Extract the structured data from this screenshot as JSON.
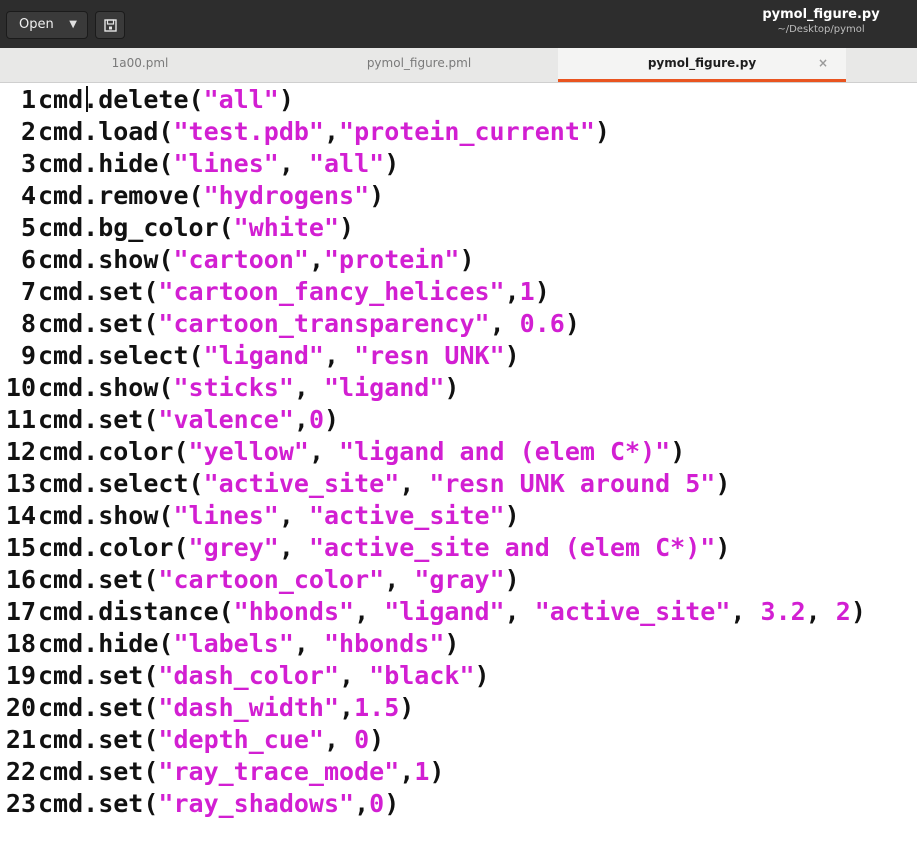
{
  "window": {
    "open_label": "Open",
    "title": "pymol_figure.py",
    "path": "~/Desktop/pymol"
  },
  "tabs": [
    {
      "label": "1a00.pml",
      "active": false
    },
    {
      "label": "pymol_figure.pml",
      "active": false
    },
    {
      "label": "pymol_figure.py",
      "active": true,
      "close": "×"
    }
  ],
  "colors": {
    "string": "#d21fd2",
    "text": "#111111",
    "tab_accent": "#e95420"
  },
  "code_lines": [
    [
      [
        "n",
        "1"
      ],
      [
        "p",
        "cmd.delete("
      ],
      [
        "s",
        "\"all\""
      ],
      [
        "p",
        ")"
      ]
    ],
    [
      [
        "n",
        "2"
      ],
      [
        "p",
        "cmd.load("
      ],
      [
        "s",
        "\"test.pdb\""
      ],
      [
        "p",
        ","
      ],
      [
        "s",
        "\"protein_current\""
      ],
      [
        "p",
        ")"
      ]
    ],
    [
      [
        "n",
        "3"
      ],
      [
        "p",
        "cmd.hide("
      ],
      [
        "s",
        "\"lines\""
      ],
      [
        "p",
        ", "
      ],
      [
        "s",
        "\"all\""
      ],
      [
        "p",
        ")"
      ]
    ],
    [
      [
        "n",
        "4"
      ],
      [
        "p",
        "cmd.remove("
      ],
      [
        "s",
        "\"hydrogens\""
      ],
      [
        "p",
        ")"
      ]
    ],
    [
      [
        "n",
        "5"
      ],
      [
        "p",
        "cmd.bg_color("
      ],
      [
        "s",
        "\"white\""
      ],
      [
        "p",
        ")"
      ]
    ],
    [
      [
        "n",
        "6"
      ],
      [
        "p",
        "cmd.show("
      ],
      [
        "s",
        "\"cartoon\""
      ],
      [
        "p",
        ","
      ],
      [
        "s",
        "\"protein\""
      ],
      [
        "p",
        ")"
      ]
    ],
    [
      [
        "n",
        "7"
      ],
      [
        "p",
        "cmd.set("
      ],
      [
        "s",
        "\"cartoon_fancy_helices\""
      ],
      [
        "p",
        ","
      ],
      [
        "s",
        "1"
      ],
      [
        "p",
        ")"
      ]
    ],
    [
      [
        "n",
        "8"
      ],
      [
        "p",
        "cmd.set("
      ],
      [
        "s",
        "\"cartoon_transparency\""
      ],
      [
        "p",
        ", "
      ],
      [
        "s",
        "0.6"
      ],
      [
        "p",
        ")"
      ]
    ],
    [
      [
        "n",
        "9"
      ],
      [
        "p",
        "cmd.select("
      ],
      [
        "s",
        "\"ligand\""
      ],
      [
        "p",
        ", "
      ],
      [
        "s",
        "\"resn UNK\""
      ],
      [
        "p",
        ")"
      ]
    ],
    [
      [
        "n",
        "10"
      ],
      [
        "p",
        "cmd.show("
      ],
      [
        "s",
        "\"sticks\""
      ],
      [
        "p",
        ", "
      ],
      [
        "s",
        "\"ligand\""
      ],
      [
        "p",
        ")"
      ]
    ],
    [
      [
        "n",
        "11"
      ],
      [
        "p",
        "cmd.set("
      ],
      [
        "s",
        "\"valence\""
      ],
      [
        "p",
        ","
      ],
      [
        "s",
        "0"
      ],
      [
        "p",
        ")"
      ]
    ],
    [
      [
        "n",
        "12"
      ],
      [
        "p",
        "cmd.color("
      ],
      [
        "s",
        "\"yellow\""
      ],
      [
        "p",
        ", "
      ],
      [
        "s",
        "\"ligand and (elem C*)\""
      ],
      [
        "p",
        ")"
      ]
    ],
    [
      [
        "n",
        "13"
      ],
      [
        "p",
        "cmd.select("
      ],
      [
        "s",
        "\"active_site\""
      ],
      [
        "p",
        ", "
      ],
      [
        "s",
        "\"resn UNK around 5\""
      ],
      [
        "p",
        ")"
      ]
    ],
    [
      [
        "n",
        "14"
      ],
      [
        "p",
        "cmd.show("
      ],
      [
        "s",
        "\"lines\""
      ],
      [
        "p",
        ", "
      ],
      [
        "s",
        "\"active_site\""
      ],
      [
        "p",
        ")"
      ]
    ],
    [
      [
        "n",
        "15"
      ],
      [
        "p",
        "cmd.color("
      ],
      [
        "s",
        "\"grey\""
      ],
      [
        "p",
        ", "
      ],
      [
        "s",
        "\"active_site and (elem C*)\""
      ],
      [
        "p",
        ")"
      ]
    ],
    [
      [
        "n",
        "16"
      ],
      [
        "p",
        "cmd.set("
      ],
      [
        "s",
        "\"cartoon_color\""
      ],
      [
        "p",
        ", "
      ],
      [
        "s",
        "\"gray\""
      ],
      [
        "p",
        ")"
      ]
    ],
    [
      [
        "n",
        "17"
      ],
      [
        "p",
        "cmd.distance("
      ],
      [
        "s",
        "\"hbonds\""
      ],
      [
        "p",
        ", "
      ],
      [
        "s",
        "\"ligand\""
      ],
      [
        "p",
        ", "
      ],
      [
        "s",
        "\"active_site\""
      ],
      [
        "p",
        ", "
      ],
      [
        "s",
        "3.2"
      ],
      [
        "p",
        ", "
      ],
      [
        "s",
        "2"
      ],
      [
        "p",
        ")"
      ]
    ],
    [
      [
        "n",
        "18"
      ],
      [
        "p",
        "cmd.hide("
      ],
      [
        "s",
        "\"labels\""
      ],
      [
        "p",
        ", "
      ],
      [
        "s",
        "\"hbonds\""
      ],
      [
        "p",
        ")"
      ]
    ],
    [
      [
        "n",
        "19"
      ],
      [
        "p",
        "cmd.set("
      ],
      [
        "s",
        "\"dash_color\""
      ],
      [
        "p",
        ", "
      ],
      [
        "s",
        "\"black\""
      ],
      [
        "p",
        ")"
      ]
    ],
    [
      [
        "n",
        "20"
      ],
      [
        "p",
        "cmd.set("
      ],
      [
        "s",
        "\"dash_width\""
      ],
      [
        "p",
        ","
      ],
      [
        "s",
        "1.5"
      ],
      [
        "p",
        ")"
      ]
    ],
    [
      [
        "n",
        "21"
      ],
      [
        "p",
        "cmd.set("
      ],
      [
        "s",
        "\"depth_cue\""
      ],
      [
        "p",
        ", "
      ],
      [
        "s",
        "0"
      ],
      [
        "p",
        ")"
      ]
    ],
    [
      [
        "n",
        "22"
      ],
      [
        "p",
        "cmd.set("
      ],
      [
        "s",
        "\"ray_trace_mode\""
      ],
      [
        "p",
        ","
      ],
      [
        "s",
        "1"
      ],
      [
        "p",
        ")"
      ]
    ],
    [
      [
        "n",
        "23"
      ],
      [
        "p",
        "cmd.set("
      ],
      [
        "s",
        "\"ray_shadows\""
      ],
      [
        "p",
        ","
      ],
      [
        "s",
        "0"
      ],
      [
        "p",
        ")"
      ]
    ]
  ]
}
